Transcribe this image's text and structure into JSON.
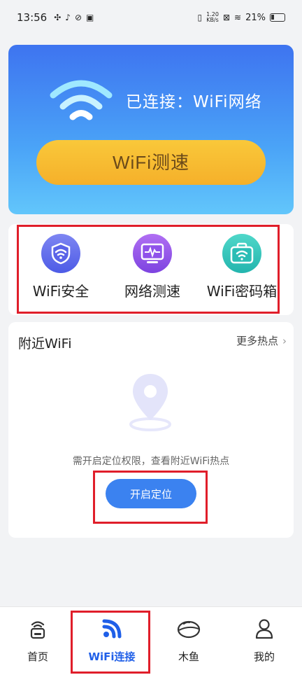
{
  "status_bar": {
    "time": "13:56",
    "net_speed_top": "1.20",
    "net_speed_bottom": "KB/s",
    "battery": "21%"
  },
  "hero": {
    "connection_status": "已连接：WiFi网络",
    "speed_test_button": "WiFi测速"
  },
  "tools": [
    {
      "label": "WiFi安全",
      "icon": "shield-wifi-icon"
    },
    {
      "label": "网络测速",
      "icon": "monitor-pulse-icon"
    },
    {
      "label": "WiFi密码箱",
      "icon": "password-box-icon"
    }
  ],
  "nearby": {
    "title": "附近WiFi",
    "more_label": "更多热点",
    "hint": "需开启定位权限，查看附近WiFi热点",
    "locate_button": "开启定位"
  },
  "bottom_nav": [
    {
      "label": "首页",
      "active": false
    },
    {
      "label": "WiFi连接",
      "active": true
    },
    {
      "label": "木鱼",
      "active": false
    },
    {
      "label": "我的",
      "active": false
    }
  ],
  "colors": {
    "accent": "#1f5fe8",
    "highlight": "#e01e2a",
    "button_yellow": "#f5b02a",
    "hero_blue": "#3e74f0"
  }
}
